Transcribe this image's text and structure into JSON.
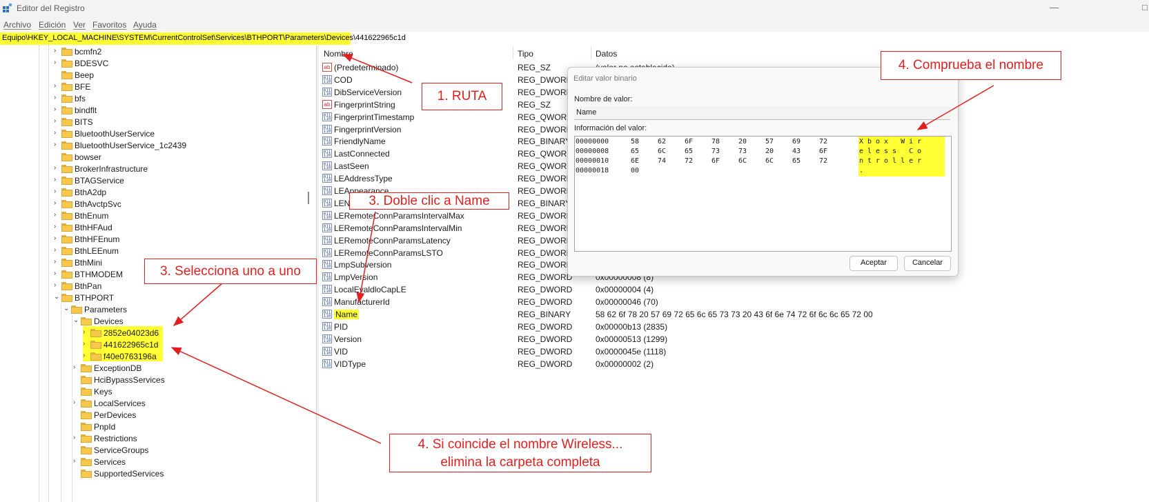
{
  "window": {
    "title": "Editor del Registro",
    "min": "—",
    "close": "✕"
  },
  "menu": [
    "Archivo",
    "Edición",
    "Ver",
    "Favoritos",
    "Ayuda"
  ],
  "address": "Equipo\\HKEY_LOCAL_MACHINE\\SYSTEM\\CurrentControlSet\\Services\\BTHPORT\\Parameters\\Devices\\441622965c1d",
  "tree": [
    {
      "label": "bcmfn2",
      "chev": "›"
    },
    {
      "label": "BDESVC",
      "chev": "›"
    },
    {
      "label": "Beep",
      "chev": ""
    },
    {
      "label": "BFE",
      "chev": "›"
    },
    {
      "label": "bfs",
      "chev": "›"
    },
    {
      "label": "bindflt",
      "chev": "›"
    },
    {
      "label": "BITS",
      "chev": "›"
    },
    {
      "label": "BluetoothUserService",
      "chev": "›"
    },
    {
      "label": "BluetoothUserService_1c2439",
      "chev": "›"
    },
    {
      "label": "bowser",
      "chev": ""
    },
    {
      "label": "BrokerInfrastructure",
      "chev": "›"
    },
    {
      "label": "BTAGService",
      "chev": "›"
    },
    {
      "label": "BthA2dp",
      "chev": "›"
    },
    {
      "label": "BthAvctpSvc",
      "chev": "›"
    },
    {
      "label": "BthEnum",
      "chev": "›"
    },
    {
      "label": "BthHFAud",
      "chev": "›"
    },
    {
      "label": "BthHFEnum",
      "chev": "›"
    },
    {
      "label": "BthLEEnum",
      "chev": "›"
    },
    {
      "label": "BthMini",
      "chev": "›"
    },
    {
      "label": "BTHMODEM",
      "chev": "›"
    },
    {
      "label": "BthPan",
      "chev": "›"
    },
    {
      "label": "BTHPORT",
      "chev": "⌄"
    },
    {
      "label": "Parameters",
      "chev": "⌄"
    },
    {
      "label": "Devices",
      "chev": "⌄"
    },
    {
      "label": "2852e04023d6",
      "chev": "›"
    },
    {
      "label": "441622965c1d",
      "chev": "›"
    },
    {
      "label": "f40e0763196a",
      "chev": "›"
    },
    {
      "label": "ExceptionDB",
      "chev": "›"
    },
    {
      "label": "HciBypassServices",
      "chev": ""
    },
    {
      "label": "Keys",
      "chev": ""
    },
    {
      "label": "LocalServices",
      "chev": "›"
    },
    {
      "label": "PerDevices",
      "chev": ""
    },
    {
      "label": "PnpId",
      "chev": ""
    },
    {
      "label": "Restrictions",
      "chev": "›"
    },
    {
      "label": "ServiceGroups",
      "chev": ""
    },
    {
      "label": "Services",
      "chev": "›"
    },
    {
      "label": "SupportedServices",
      "chev": ""
    }
  ],
  "columns": {
    "name": "Nombre",
    "type": "Tipo",
    "data": "Datos"
  },
  "values": [
    {
      "name": "(Predeterminado)",
      "type": "REG_SZ",
      "data": "(valor no establecido)",
      "icon": "ab"
    },
    {
      "name": "COD",
      "type": "REG_DWORD",
      "data": "",
      "icon": "bin"
    },
    {
      "name": "DibServiceVersion",
      "type": "REG_DWORD",
      "data": "",
      "icon": "bin"
    },
    {
      "name": "FingerprintString",
      "type": "REG_SZ",
      "data": "",
      "icon": "ab"
    },
    {
      "name": "FingerprintTimestamp",
      "type": "REG_QWORD",
      "data": "",
      "icon": "bin"
    },
    {
      "name": "FingerprintVersion",
      "type": "REG_DWORD",
      "data": "",
      "icon": "bin"
    },
    {
      "name": "FriendlyName",
      "type": "REG_BINARY",
      "data": "",
      "icon": "bin"
    },
    {
      "name": "LastConnected",
      "type": "REG_QWORD",
      "data": "",
      "icon": "bin"
    },
    {
      "name": "LastSeen",
      "type": "REG_QWORD",
      "data": "",
      "icon": "bin"
    },
    {
      "name": "LEAddressType",
      "type": "REG_DWORD",
      "data": "",
      "icon": "bin"
    },
    {
      "name": "LEAppearance",
      "type": "REG_DWORD",
      "data": "",
      "icon": "bin"
    },
    {
      "name": "LEName",
      "type": "REG_BINARY",
      "data": "",
      "icon": "bin"
    },
    {
      "name": "LERemoteConnParamsIntervalMax",
      "type": "REG_DWORD",
      "data": "",
      "icon": "bin"
    },
    {
      "name": "LERemoteConnParamsIntervalMin",
      "type": "REG_DWORD",
      "data": "",
      "icon": "bin"
    },
    {
      "name": "LERemoteConnParamsLatency",
      "type": "REG_DWORD",
      "data": "",
      "icon": "bin"
    },
    {
      "name": "LERemoteConnParamsLSTO",
      "type": "REG_DWORD",
      "data": "",
      "icon": "bin"
    },
    {
      "name": "LmpSubversion",
      "type": "REG_DWORD",
      "data": "",
      "icon": "bin"
    },
    {
      "name": "LmpVersion",
      "type": "REG_DWORD",
      "data": "0x00000008 (8)",
      "icon": "bin"
    },
    {
      "name": "LocalEvaldloCapLE",
      "type": "REG_DWORD",
      "data": "0x00000004 (4)",
      "icon": "bin"
    },
    {
      "name": "ManufacturerId",
      "type": "REG_DWORD",
      "data": "0x00000046 (70)",
      "icon": "bin"
    },
    {
      "name": "Name",
      "type": "REG_BINARY",
      "data": "58 62 6f 78 20 57 69 72 65 6c 65 73 73 20 43 6f 6e 74 72 6f 6c 6c 65 72 00",
      "icon": "bin",
      "highlight": true
    },
    {
      "name": "PID",
      "type": "REG_DWORD",
      "data": "0x00000b13 (2835)",
      "icon": "bin"
    },
    {
      "name": "Version",
      "type": "REG_DWORD",
      "data": "0x00000513 (1299)",
      "icon": "bin"
    },
    {
      "name": "VID",
      "type": "REG_DWORD",
      "data": "0x0000045e (1118)",
      "icon": "bin"
    },
    {
      "name": "VIDType",
      "type": "REG_DWORD",
      "data": "0x00000002 (2)",
      "icon": "bin"
    }
  ],
  "dialog": {
    "title": "Editar valor binario",
    "close": "✕",
    "name_label": "Nombre de valor:",
    "name_value": "Name",
    "data_label": "Información del valor:",
    "hex_rows": [
      {
        "offset": "00000000",
        "bytes": [
          "58",
          "62",
          "6F",
          "78",
          "20",
          "57",
          "69",
          "72"
        ]
      },
      {
        "offset": "00000008",
        "bytes": [
          "65",
          "6C",
          "65",
          "73",
          "73",
          "20",
          "43",
          "6F"
        ]
      },
      {
        "offset": "00000010",
        "bytes": [
          "6E",
          "74",
          "72",
          "6F",
          "6C",
          "6C",
          "65",
          "72"
        ]
      },
      {
        "offset": "00000018",
        "bytes": [
          "00"
        ]
      }
    ],
    "ascii": [
      "Xbox Wir",
      "eless Co",
      "ntroller",
      "."
    ],
    "ok": "Aceptar",
    "cancel": "Cancelar"
  },
  "annotations": {
    "ruta": "1. RUTA",
    "doble_clic": "3. Doble clic a Name",
    "selecciona": "3. Selecciona uno a uno",
    "comprueba": "4. Comprueba el nombre",
    "elimina_1": "4. Si coincide el nombre Wireless...",
    "elimina_2": "elimina la carpeta completa"
  }
}
